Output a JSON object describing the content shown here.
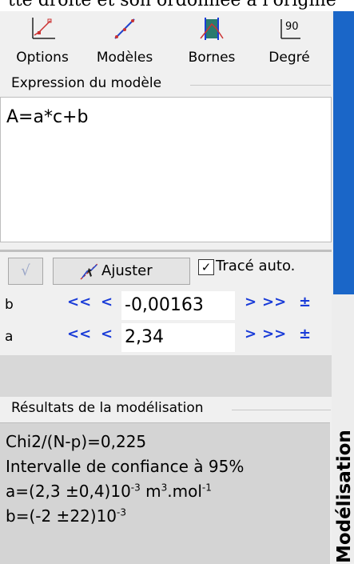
{
  "top_cut_text": "tte droite et son ordonnée à l'origine",
  "toolbar": {
    "options": {
      "label": "Options",
      "icon": "options-chart-icon"
    },
    "modeles": {
      "label": "Modèles",
      "icon": "model-line-icon"
    },
    "bornes": {
      "label": "Bornes",
      "icon": "bounds-bars-icon"
    },
    "degre": {
      "label": "Degré",
      "icon": "degree-90-icon",
      "icon_text": "90"
    }
  },
  "expression": {
    "title": "Expression du modèle",
    "value": "A=a*c+b"
  },
  "fit": {
    "check_icon": "check-icon",
    "ajuster_label": "Ajuster",
    "trace_auto_label": "Tracé auto.",
    "trace_auto_checked": true
  },
  "params": [
    {
      "name": "b",
      "value": "-0,00163"
    },
    {
      "name": "a",
      "value": "2,34"
    }
  ],
  "nav": {
    "fast_back": "<<",
    "back": "<",
    "fwd": ">",
    "fast_fwd": ">>",
    "plusminus": "±"
  },
  "results": {
    "title": "Résultats de la modélisation",
    "chi2": "Chi2/(N-p)=0,225",
    "interval": "Intervalle de confiance à 95%",
    "a_line_base": "a=(2,3 ±0,4)10",
    "a_exp": "-3",
    "a_unit_1": " m",
    "a_unit_exp1": "3",
    "a_unit_2": ".mol",
    "a_unit_exp2": "-1",
    "b_line_base": "b=(-2 ±22)10",
    "b_exp": "-3"
  },
  "side_tab": {
    "label": "Modélisation"
  },
  "colors": {
    "accent_blue": "#1a66c8",
    "nav_blue": "#1a3cd8",
    "pm_red": "#d42a2a",
    "results_bg": "#d4d4d4"
  }
}
